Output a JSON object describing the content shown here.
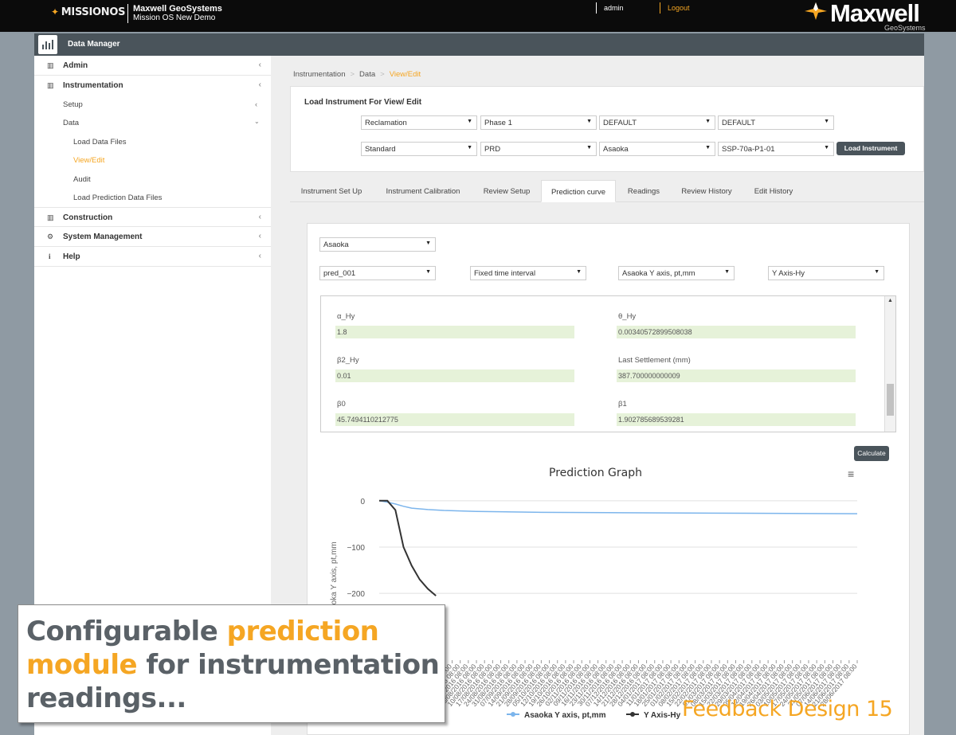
{
  "header": {
    "product_logo": "MISSIONOS",
    "org_name": "Maxwell GeoSystems",
    "org_sub": "Mission OS New Demo",
    "user": "admin",
    "logout": "Logout",
    "brand_logo": "Maxwell",
    "brand_sub": "GeoSystems"
  },
  "module": {
    "title": "Data Manager"
  },
  "sidebar": {
    "items": [
      {
        "label": "Admin"
      },
      {
        "label": "Instrumentation"
      },
      {
        "label": "Setup"
      },
      {
        "label": "Data"
      },
      {
        "label": "Load Data Files"
      },
      {
        "label": "View/Edit"
      },
      {
        "label": "Audit"
      },
      {
        "label": "Load Prediction Data Files"
      },
      {
        "label": "Construction"
      },
      {
        "label": "System Management"
      },
      {
        "label": "Help"
      }
    ]
  },
  "breadcrumb": [
    "Instrumentation",
    "Data",
    "View/Edit"
  ],
  "load_panel": {
    "title": "Load Instrument For View/ Edit",
    "row1": [
      "Reclamation",
      "Phase 1",
      "DEFAULT",
      "DEFAULT"
    ],
    "row2": [
      "Standard",
      "PRD",
      "Asaoka",
      "SSP-70a-P1-01"
    ],
    "button": "Load Instrument"
  },
  "tabs": [
    {
      "label": "Instrument Set Up"
    },
    {
      "label": "Instrument Calibration"
    },
    {
      "label": "Review Setup"
    },
    {
      "label": "Prediction curve",
      "active": true
    },
    {
      "label": "Readings"
    },
    {
      "label": "Review History"
    },
    {
      "label": "Edit History"
    }
  ],
  "prediction": {
    "method": "Asaoka",
    "filters": [
      "pred_001",
      "Fixed time interval",
      "Asaoka Y axis, pt,mm",
      "Y Axis-Hy"
    ],
    "params": [
      {
        "label": "α_Hy",
        "value": "1.8"
      },
      {
        "label": "θ_Hy",
        "value": "0.00340572899508038"
      },
      {
        "label": "β2_Hy",
        "value": "0.01"
      },
      {
        "label": "Last Settlement (mm)",
        "value": "387.700000000009"
      },
      {
        "label": "β0",
        "value": "45.7494110212775"
      },
      {
        "label": "β1",
        "value": "1.902785689539281"
      }
    ],
    "calculate": "Calculate"
  },
  "chart_data": {
    "type": "line",
    "title": "Prediction Graph",
    "ylabel": "Y Axis-Hy,Asaoka Y axis, pt,mm",
    "y_ticks": [
      0,
      -100,
      -200
    ],
    "x_ticks": [
      "11/05/2016 08:00",
      "18/05/2016 08:00",
      "25/05/2016 08:00",
      "01/06/2016 08:00",
      "08/06/2016 08:00",
      "15/06/2016 08:00",
      "22/06/2016 08:00",
      "29/06/2016 08:00",
      "06/07/2016 08:00",
      "13/07/2016 08:00",
      "20/07/2016 08:00",
      "27/07/2016 08:00",
      "03/08/2016 08:00",
      "10/08/2016 08:00",
      "17/08/2016 08:00",
      "24/08/2016 08:00",
      "31/08/2016 08:00",
      "07/09/2016 08:00",
      "14/09/2016 08:00",
      "21/09/2016 08:00",
      "28/09/2016 08:00",
      "05/10/2016 08:00",
      "12/10/2016 08:00",
      "19/10/2016 08:00",
      "26/10/2016 08:00",
      "02/11/2016 08:00",
      "09/11/2016 08:00",
      "16/11/2016 08:00",
      "23/11/2016 08:00",
      "30/11/2016 08:00",
      "07/12/2016 08:00",
      "14/12/2016 08:00",
      "21/12/2016 08:00",
      "28/12/2016 08:00",
      "04/01/2017 08:00",
      "11/01/2017 08:00",
      "18/01/2017 08:00",
      "25/01/2017 08:00",
      "01/02/2017 08:00",
      "08/02/2017 08:00",
      "15/02/2017 08:00",
      "22/02/2017 08:00",
      "01/03/2017 08:00",
      "08/03/2017 08:00",
      "15/03/2017 08:00",
      "22/03/2017 08:00",
      "29/03/2017 08:00",
      "05/04/2017 08:00",
      "12/04/2017 08:00",
      "19/04/2017 08:00",
      "26/04/2017 08:00",
      "03/05/2017 08:00",
      "10/05/2017 08:00",
      "17/05/2017 08:00",
      "24/05/2017 08:00",
      "31/05/2017 08:00",
      "07/06/2017 08:00",
      "14/06/2017 08:00",
      "21/06/2017 08:00",
      "28/06/2017 08:00"
    ],
    "series": [
      {
        "name": "Asaoka Y axis, pt,mm",
        "color": "#7cb5ec",
        "x": [
          0,
          1,
          2,
          3,
          4,
          6,
          8,
          12,
          20,
          30,
          45,
          59
        ],
        "y": [
          0,
          -3,
          -7,
          -12,
          -16,
          -19,
          -21,
          -23,
          -25,
          -26,
          -27,
          -28
        ]
      },
      {
        "name": "Y Axis-Hy",
        "color": "#333333",
        "x": [
          0,
          1,
          2,
          3,
          4,
          5,
          6,
          7
        ],
        "y": [
          0,
          0,
          -20,
          -100,
          -140,
          -170,
          -190,
          -205
        ]
      }
    ],
    "ylim": [
      -210,
      10
    ],
    "legend": "bottom"
  },
  "overlay": {
    "line1_a": "Configurable ",
    "line1_b": "prediction",
    "line2_a": "module",
    "line2_b": " for instrumentation",
    "line3": "readings...",
    "footer": "Feedback Design 15"
  }
}
